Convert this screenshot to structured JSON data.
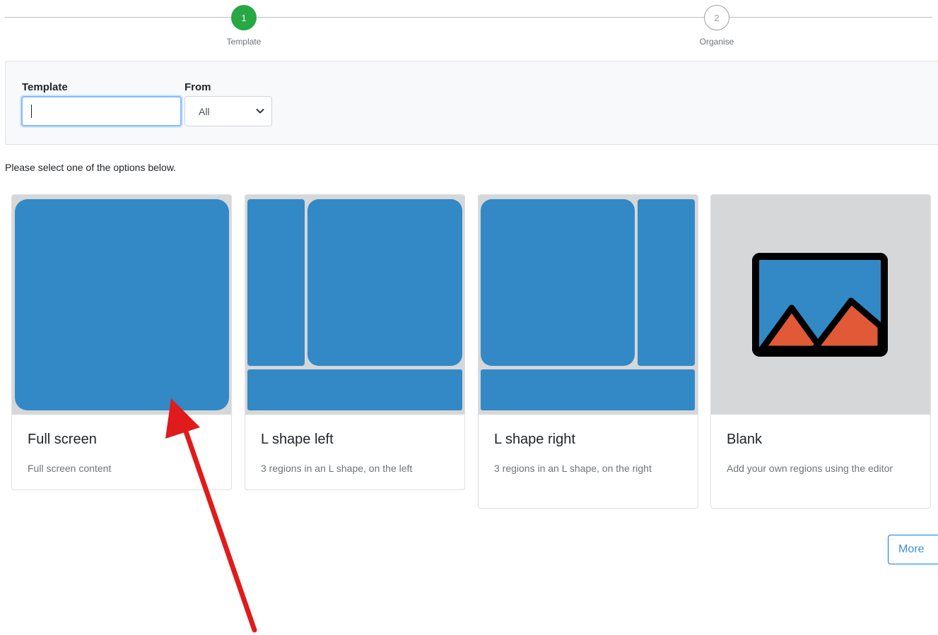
{
  "stepper": {
    "steps": [
      {
        "number": "1",
        "label": "Template"
      },
      {
        "number": "2",
        "label": "Organise"
      }
    ]
  },
  "filters": {
    "template_label": "Template",
    "template_value": "",
    "from_label": "From",
    "from_value": "All"
  },
  "instructions": "Please select one of the options below.",
  "cards": [
    {
      "title": "Full screen",
      "description": "Full screen content"
    },
    {
      "title": "L shape left",
      "description": "3 regions in an L shape, on the left"
    },
    {
      "title": "L shape right",
      "description": "3 regions in an L shape, on the right"
    },
    {
      "title": "Blank",
      "description": "Add your own regions using the editor"
    }
  ],
  "more_label": "More",
  "colors": {
    "accent_green": "#28a745",
    "region_blue": "#3289c6",
    "thumb_gray": "#d6d7d9",
    "image_orange": "#e05a37",
    "arrow_red": "#e01b1b"
  },
  "icons": {
    "blank_card": "image-placeholder-icon",
    "select": "chevron-down-icon"
  }
}
